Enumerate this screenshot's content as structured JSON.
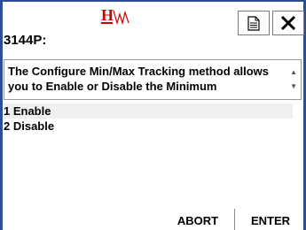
{
  "header": {
    "doc_icon": "document-icon",
    "close_icon": "close-icon",
    "close_glyph": "✕",
    "logo_colors": {
      "h": "#cc0000",
      "wave": "#cc0000"
    }
  },
  "device": {
    "title": "3144P:"
  },
  "help": {
    "text": "The Configure Min/Max Tracking method allows you to Enable or Disable the Minimum"
  },
  "options": [
    {
      "label": "1 Enable",
      "selected": true
    },
    {
      "label": "2 Disable",
      "selected": false
    }
  ],
  "footer": {
    "abort_label": "ABORT",
    "enter_label": "ENTER"
  },
  "colors": {
    "frame": "#2a4f96",
    "selected_row": "#efefef"
  }
}
